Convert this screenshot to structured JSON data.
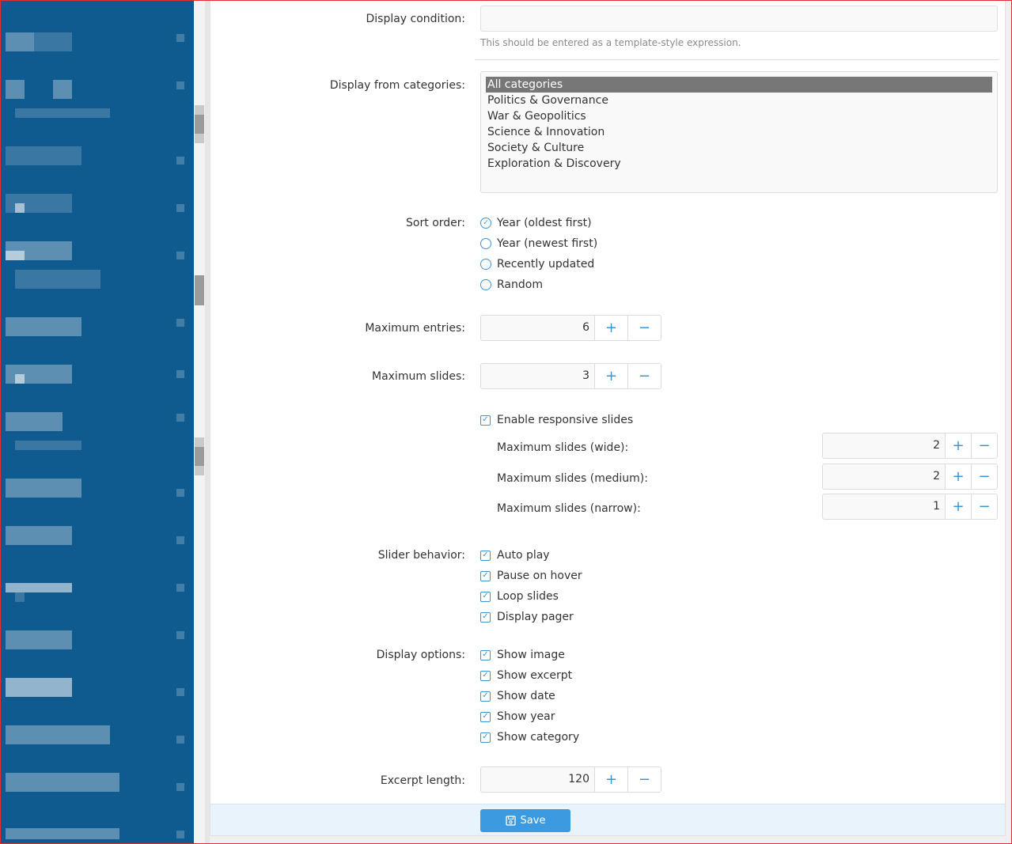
{
  "form": {
    "display_condition": {
      "label": "Display condition:",
      "value": "",
      "help": "This should be entered as a template-style expression."
    },
    "categories": {
      "label": "Display from categories:",
      "options": [
        "All categories",
        "Politics & Governance",
        "War & Geopolitics",
        "Science & Innovation",
        "Society & Culture",
        "Exploration & Discovery"
      ],
      "selected": "All categories"
    },
    "sort_order": {
      "label": "Sort order:",
      "options": [
        "Year (oldest first)",
        "Year (newest first)",
        "Recently updated",
        "Random"
      ],
      "selected": "Year (oldest first)"
    },
    "max_entries": {
      "label": "Maximum entries:",
      "value": "6"
    },
    "max_slides": {
      "label": "Maximum slides:",
      "value": "3"
    },
    "responsive": {
      "label": "Enable responsive slides",
      "checked": true,
      "wide": {
        "label": "Maximum slides (wide):",
        "value": "2"
      },
      "medium": {
        "label": "Maximum slides (medium):",
        "value": "2"
      },
      "narrow": {
        "label": "Maximum slides (narrow):",
        "value": "1"
      }
    },
    "slider_behavior": {
      "label": "Slider behavior:",
      "items": [
        "Auto play",
        "Pause on hover",
        "Loop slides",
        "Display pager"
      ]
    },
    "display_options": {
      "label": "Display options:",
      "items": [
        "Show image",
        "Show excerpt",
        "Show date",
        "Show year",
        "Show category"
      ]
    },
    "excerpt_length": {
      "label": "Excerpt length:",
      "value": "120"
    }
  },
  "stepper": {
    "plus": "+",
    "minus": "−"
  },
  "footer": {
    "save_label": "Save"
  },
  "colors": {
    "sidebar": "#0f5a8e",
    "accent": "#3c95d3",
    "save": "#3c9be0"
  }
}
